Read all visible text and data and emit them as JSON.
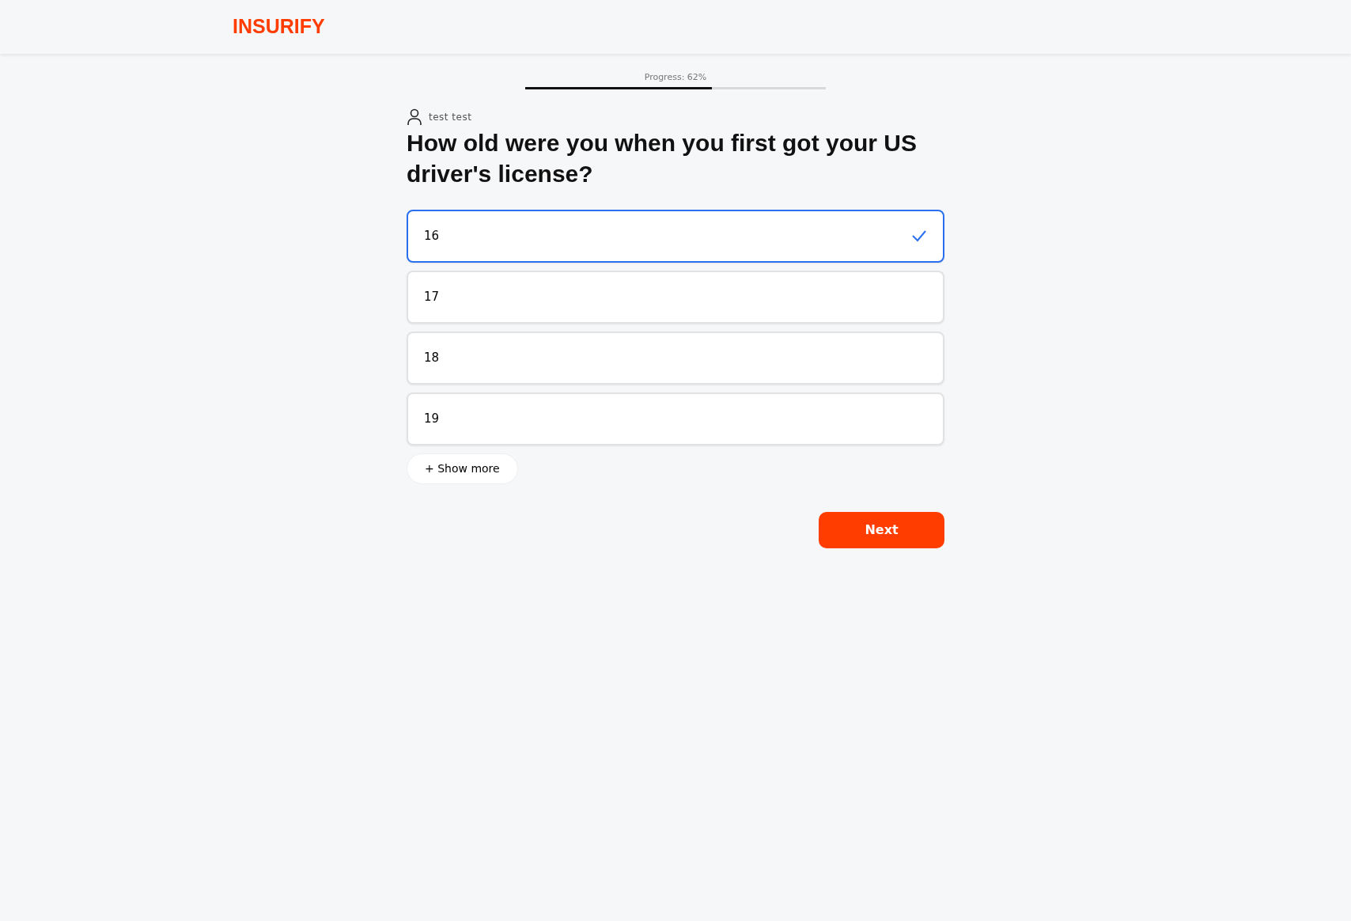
{
  "header": {
    "logo": "INSURIFY"
  },
  "progress": {
    "label": "Progress: 62%",
    "level": 0.62
  },
  "user": {
    "name": "test test"
  },
  "question": "How old were you when you first got your US driver's license?",
  "options": [
    {
      "label": "16",
      "selected": true
    },
    {
      "label": "17",
      "selected": false
    },
    {
      "label": "18",
      "selected": false
    },
    {
      "label": "19",
      "selected": false
    }
  ],
  "show_more": "+ Show more",
  "next_button": "Next"
}
